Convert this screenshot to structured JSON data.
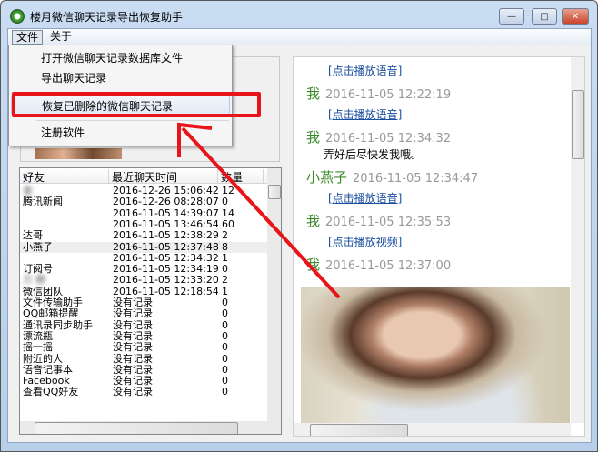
{
  "window": {
    "title": "楼月微信聊天记录导出恢复助手",
    "minimize": "—",
    "maximize": "□",
    "close": "✕"
  },
  "menubar": {
    "file": "文件",
    "about": "关于"
  },
  "file_menu": {
    "items": [
      "打开微信聊天记录数据库文件",
      "导出聊天记录",
      "恢复已删除的微信聊天记录",
      "注册软件"
    ],
    "highlighted": "恢复已删除的微信聊天记录"
  },
  "friends": {
    "headers": [
      "好友",
      "最近聊天时间",
      "数量"
    ],
    "rows": [
      {
        "name": "金",
        "time": "2016-12-26 15:06:42",
        "count": "12",
        "blurred": true
      },
      {
        "name": "腾讯新闻",
        "time": "2016-12-26 08:28:07",
        "count": "0"
      },
      {
        "name": "",
        "time": "2016-11-05 14:39:07",
        "count": "14",
        "blurred": true
      },
      {
        "name": "",
        "time": "2016-11-05 13:46:54",
        "count": "60",
        "blurred": true
      },
      {
        "name": "达哥",
        "time": "2016-11-05 12:38:29",
        "count": "2"
      },
      {
        "name": "小燕子",
        "time": "2016-11-05 12:37:48",
        "count": "8",
        "selected": true
      },
      {
        "name": "",
        "time": "2016-11-05 12:34:32",
        "count": "1",
        "blurred": true
      },
      {
        "name": "订阅号",
        "time": "2016-11-05 12:34:19",
        "count": "0"
      },
      {
        "name": "万 群",
        "time": "2016-11-05 12:33:20",
        "count": "2",
        "blurred": true
      },
      {
        "name": "微信团队",
        "time": "2016-11-05 12:18:54",
        "count": "1"
      },
      {
        "name": "文件传输助手",
        "time": "没有记录",
        "count": "0"
      },
      {
        "name": "QQ邮箱提醒",
        "time": "没有记录",
        "count": "0"
      },
      {
        "name": "通讯录同步助手",
        "time": "没有记录",
        "count": "0"
      },
      {
        "name": "漂流瓶",
        "time": "没有记录",
        "count": "0"
      },
      {
        "name": "摇一摇",
        "time": "没有记录",
        "count": "0"
      },
      {
        "name": "附近的人",
        "time": "没有记录",
        "count": "0"
      },
      {
        "name": "语音记事本",
        "time": "没有记录",
        "count": "0"
      },
      {
        "name": "Facebook",
        "time": "没有记录",
        "count": "0"
      },
      {
        "name": "查看QQ好友",
        "time": "没有记录",
        "count": "0"
      }
    ]
  },
  "chat": {
    "messages": [
      {
        "type": "link",
        "text": "[点击播放语音]"
      },
      {
        "type": "sender",
        "who": "我",
        "time": "2016-11-05 12:22:19"
      },
      {
        "type": "link",
        "text": "[点击播放语音]"
      },
      {
        "type": "sender",
        "who": "我",
        "time": "2016-11-05 12:34:32"
      },
      {
        "type": "text",
        "text": "弄好后尽快发我哦。"
      },
      {
        "type": "sender",
        "who": "小燕子",
        "time": "2016-11-05 12:34:47"
      },
      {
        "type": "link",
        "text": "[点击播放语音]"
      },
      {
        "type": "sender",
        "who": "我",
        "time": "2016-11-05 12:35:53"
      },
      {
        "type": "link",
        "text": "[点击播放视频]"
      },
      {
        "type": "sender",
        "who": "我",
        "time": "2016-11-05 12:37:00"
      }
    ]
  },
  "colors": {
    "annotation_red": "#e8141a",
    "sender_green": "#3a8a2a",
    "link_blue": "#1a4fa0"
  }
}
